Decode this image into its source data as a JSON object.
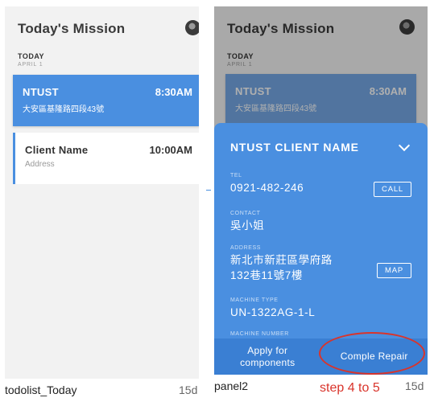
{
  "screen1": {
    "title": "Today's Mission",
    "day": "TODAY",
    "date": "APRIL 1",
    "cards": [
      {
        "name": "NTUST",
        "time": "8:30AM",
        "sub": "大安區基隆路四段43號"
      },
      {
        "name": "Client Name",
        "time": "10:00AM",
        "sub": "Address"
      }
    ]
  },
  "screen2": {
    "title": "Today's Mission",
    "day": "TODAY",
    "date": "APRIL 1",
    "card": {
      "name": "NTUST",
      "time": "8:30AM",
      "sub": "大安區基隆路四段43號"
    },
    "panel": {
      "title": "NTUST CLIENT NAME",
      "tel_label": "TEL",
      "tel": "0921-482-246",
      "call_label": "CALL",
      "contact_label": "CONTACT",
      "contact": "吳小姐",
      "address_label": "ADDRESS",
      "address_line1": "新北市新莊區學府路",
      "address_line2": "132巷11號7樓",
      "map_label": "MAP",
      "machine_type_label": "MACHINE TYPE",
      "machine_type": "UN-1322AG-1-L",
      "machine_number_label": "MACHINE NUMBER",
      "apply_line1": "Apply for",
      "apply_line2": "components",
      "complete_label": "Comple Repair"
    }
  },
  "captions": {
    "left_name": "todolist_Today",
    "left_age": "15d",
    "right_name": "panel2",
    "right_age": "15d",
    "annotation": "step 4 to 5"
  },
  "colors": {
    "primary": "#4a8fe0",
    "annotation": "#d9342b"
  }
}
